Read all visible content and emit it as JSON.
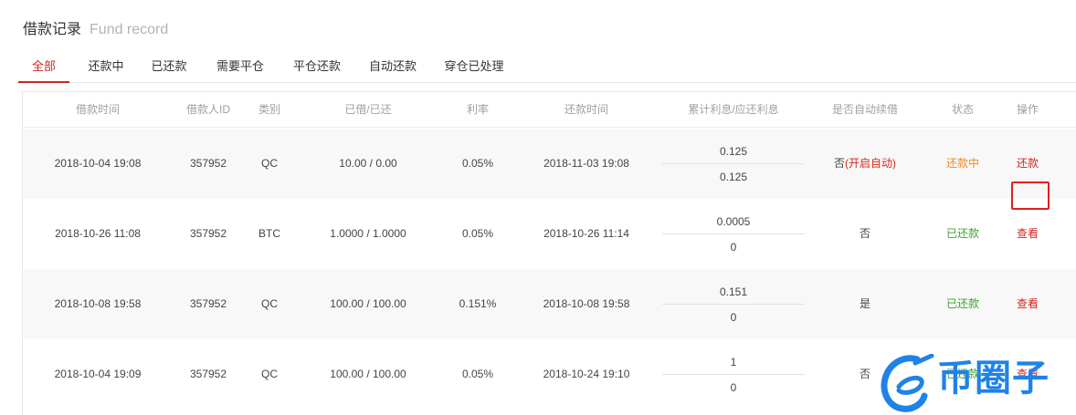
{
  "header": {
    "title": "借款记录",
    "subtitle": "Fund record"
  },
  "tabs": [
    {
      "label": "全部",
      "active": true
    },
    {
      "label": "还款中"
    },
    {
      "label": "已还款"
    },
    {
      "label": "需要平仓"
    },
    {
      "label": "平仓还款"
    },
    {
      "label": "自动还款"
    },
    {
      "label": "穿仓已处理"
    }
  ],
  "table": {
    "columns": [
      "借款时间",
      "借款人ID",
      "类别",
      "已借/已还",
      "利率",
      "还款时间",
      "累计利息/应还利息",
      "是否自动续借",
      "状态",
      "操作"
    ],
    "rows": [
      {
        "borrow_time": "2018-10-04 19:08",
        "user_id": "357952",
        "type": "QC",
        "borrowed": "10.00 / 0.00",
        "rate": "0.05%",
        "repay_time": "2018-11-03 19:08",
        "interest_accrued": "0.125",
        "interest_due": "0.125",
        "auto": "否",
        "auto_link": "(开启自动)",
        "status": "还款中",
        "action": "还款"
      },
      {
        "borrow_time": "2018-10-26 11:08",
        "user_id": "357952",
        "type": "BTC",
        "borrowed": "1.0000 / 1.0000",
        "rate": "0.05%",
        "repay_time": "2018-10-26 11:14",
        "interest_accrued": "0.0005",
        "interest_due": "0",
        "auto": "否",
        "status": "已还款",
        "action": "查看"
      },
      {
        "borrow_time": "2018-10-08 19:58",
        "user_id": "357952",
        "type": "QC",
        "borrowed": "100.00 / 100.00",
        "rate": "0.151%",
        "repay_time": "2018-10-08 19:58",
        "interest_accrued": "0.151",
        "interest_due": "0",
        "auto": "是",
        "status": "已还款",
        "action": "查看"
      },
      {
        "borrow_time": "2018-10-04 19:09",
        "user_id": "357952",
        "type": "QC",
        "borrowed": "100.00 / 100.00",
        "rate": "0.05%",
        "repay_time": "2018-10-24 19:10",
        "interest_accrued": "1",
        "interest_due": "0",
        "auto": "否",
        "status": "已还款",
        "action": "查看"
      }
    ]
  },
  "watermark": {
    "text": "币圈子",
    "logo_icon": "e-logo-icon"
  },
  "colors": {
    "accent": "#d0261f",
    "repaying": "#ee8a1c",
    "repaid": "#3fa12f",
    "watermark": "#1f82e8"
  }
}
